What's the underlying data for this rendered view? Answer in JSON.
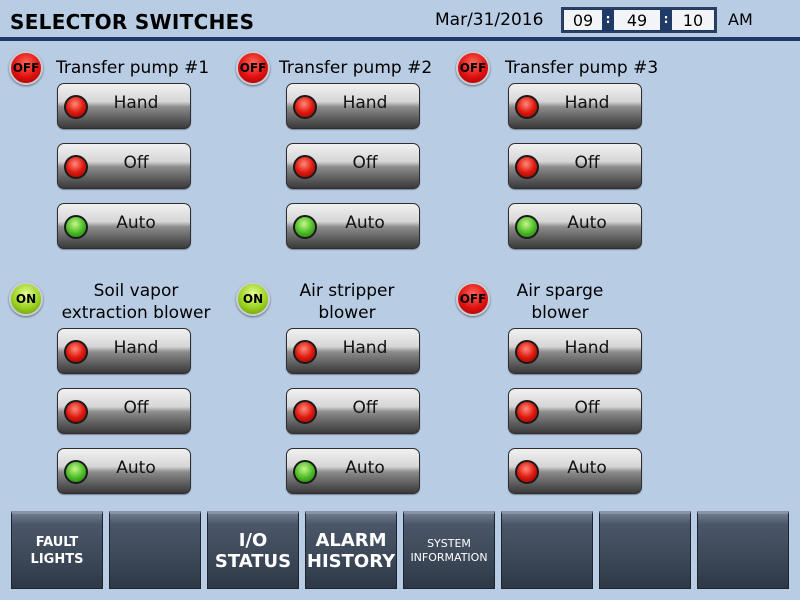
{
  "header": {
    "title": "SELECTOR SWITCHES",
    "date": "Mar/31/2016",
    "time": {
      "hh": "09",
      "mm": "49",
      "ss": "10",
      "ampm": "AM"
    }
  },
  "groups": [
    {
      "name": "Transfer pump #1",
      "status": "OFF",
      "buttons": [
        {
          "label": "Hand",
          "lamp": "red"
        },
        {
          "label": "Off",
          "lamp": "red"
        },
        {
          "label": "Auto",
          "lamp": "green"
        }
      ]
    },
    {
      "name": "Transfer pump #2",
      "status": "OFF",
      "buttons": [
        {
          "label": "Hand",
          "lamp": "red"
        },
        {
          "label": "Off",
          "lamp": "red"
        },
        {
          "label": "Auto",
          "lamp": "green"
        }
      ]
    },
    {
      "name": "Transfer pump #3",
      "status": "OFF",
      "buttons": [
        {
          "label": "Hand",
          "lamp": "red"
        },
        {
          "label": "Off",
          "lamp": "red"
        },
        {
          "label": "Auto",
          "lamp": "green"
        }
      ]
    },
    {
      "name_line1": "Soil vapor",
      "name_line2": "extraction blower",
      "status": "ON",
      "buttons": [
        {
          "label": "Hand",
          "lamp": "red"
        },
        {
          "label": "Off",
          "lamp": "red"
        },
        {
          "label": "Auto",
          "lamp": "green"
        }
      ]
    },
    {
      "name_line1": "Air stripper",
      "name_line2": "blower",
      "status": "ON",
      "buttons": [
        {
          "label": "Hand",
          "lamp": "red"
        },
        {
          "label": "Off",
          "lamp": "red"
        },
        {
          "label": "Auto",
          "lamp": "green"
        }
      ]
    },
    {
      "name_line1": "Air sparge",
      "name_line2": "blower",
      "status": "OFF",
      "buttons": [
        {
          "label": "Hand",
          "lamp": "red"
        },
        {
          "label": "Off",
          "lamp": "red"
        },
        {
          "label": "Auto",
          "lamp": "red"
        }
      ]
    }
  ],
  "nav": [
    {
      "line1": "FAULT",
      "line2": "LIGHTS"
    },
    {
      "line1": "",
      "line2": ""
    },
    {
      "line1": "I/O",
      "line2": "STATUS"
    },
    {
      "line1": "ALARM",
      "line2": "HISTORY"
    },
    {
      "line1": "SYSTEM",
      "line2": "INFORMATION"
    },
    {
      "line1": "",
      "line2": ""
    },
    {
      "line1": "",
      "line2": ""
    },
    {
      "line1": "",
      "line2": ""
    }
  ],
  "colors": {
    "background": "#b8cce4",
    "header_line": "#1f3a64",
    "nav_button": "#3c4858",
    "lamp_red": "#e01a10",
    "lamp_green": "#4fbf2a"
  }
}
